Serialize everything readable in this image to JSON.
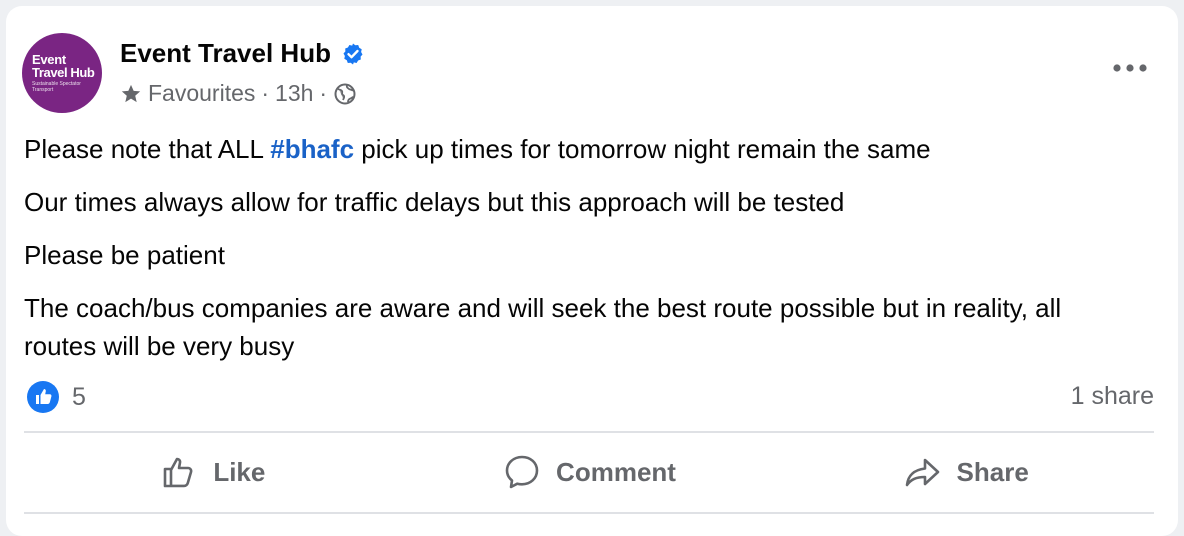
{
  "post": {
    "author": {
      "name": "Event Travel Hub",
      "avatar_line1": "Event",
      "avatar_line2": "Travel Hub",
      "avatar_tagline": "Sustainable Spectator Transport",
      "avatar_color": "#7a2583",
      "verified": true
    },
    "meta": {
      "audience": "Favourites",
      "separator": "·",
      "time": "13h",
      "privacy_icon": "globe-icon"
    },
    "text": {
      "p1_before": "Please note that ALL ",
      "p1_hashtag": "#bhafc",
      "p1_after": " pick up times for tomorrow night remain the same",
      "p2": "Our times always allow for traffic delays but this approach will be tested",
      "p3": "Please be patient",
      "p4": "The coach/bus companies are aware and will seek the best route possible but in reality, all routes will be very busy"
    },
    "stats": {
      "reaction_count": "5",
      "shares": "1 share"
    },
    "actions": {
      "like": "Like",
      "comment": "Comment",
      "share": "Share"
    }
  },
  "colors": {
    "link": "#1a62c7",
    "secondary_text": "#65676b",
    "verified": "#1877f2"
  }
}
